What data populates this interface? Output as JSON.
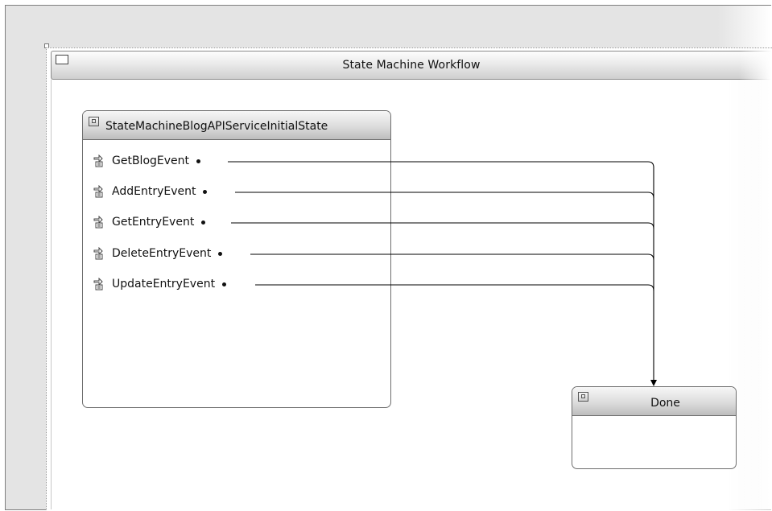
{
  "workflow": {
    "title": "State Machine Workflow"
  },
  "states": {
    "initial": {
      "title": "StateMachineBlogAPIServiceInitialState",
      "events": [
        {
          "label": "GetBlogEvent"
        },
        {
          "label": "AddEntryEvent"
        },
        {
          "label": "GetEntryEvent"
        },
        {
          "label": "DeleteEntryEvent"
        },
        {
          "label": "UpdateEntryEvent"
        }
      ]
    },
    "done": {
      "title": "Done"
    }
  },
  "icons": {
    "workflow": "window-frame-icon",
    "state": "state-activity-icon",
    "completed_state": "completed-state-icon",
    "event": "event-driven-activity-icon"
  },
  "colors": {
    "canvas": "#e4e4e4",
    "workflow_bg": "#ffffff",
    "border": "#6e6e6e",
    "connector": "#000000"
  }
}
